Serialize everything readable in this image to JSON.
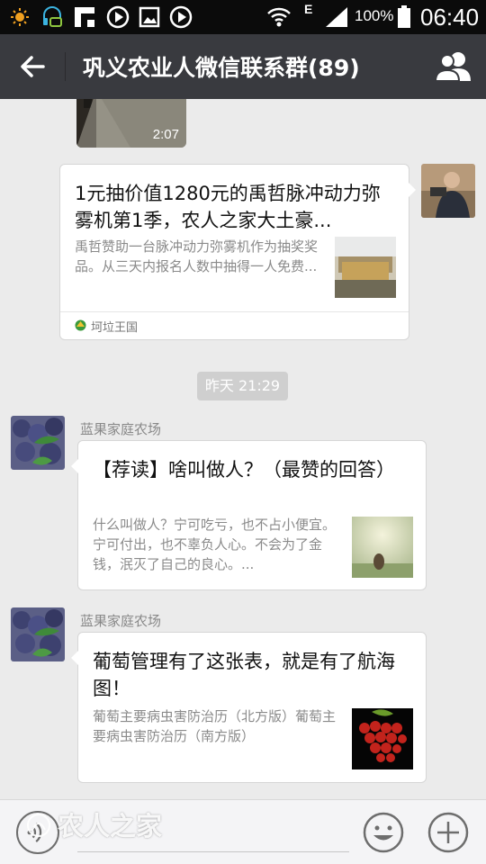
{
  "status_bar": {
    "network_label": "E",
    "battery_percent": "100%",
    "time": "06:40"
  },
  "header": {
    "title": "巩义农业人微信联系群(89)"
  },
  "chat": {
    "video": {
      "duration": "2:07"
    },
    "messages": [
      {
        "title": "1元抽价值1280元的禹哲脉冲动力弥雾机第1季，农人之家大土豪...",
        "description": "禹哲赞助一台脉冲动力弥雾机作为抽奖奖品。从三天内报名人数中抽得一人免费...",
        "source": "坷垃王国"
      },
      {
        "sender": "蓝果家庭农场",
        "title": "【荐读】啥叫做人？（最赞的回答）",
        "description": "什么叫做人？宁可吃亏，也不占小便宜。宁可付出，也不辜负人心。不会为了金钱，泯灭了自己的良心。..."
      },
      {
        "sender": "蓝果家庭农场",
        "title": "葡萄管理有了这张表，就是有了航海图！",
        "description": "葡萄主要病虫害防治历（北方版）葡萄主要病虫害防治历（南方版）"
      }
    ],
    "timestamp": "昨天 21:29"
  },
  "watermark": "农人之家",
  "colors": {
    "header_bg": "#393a3f",
    "chat_bg": "#ebebeb",
    "status_bg": "#0b0b0b"
  }
}
